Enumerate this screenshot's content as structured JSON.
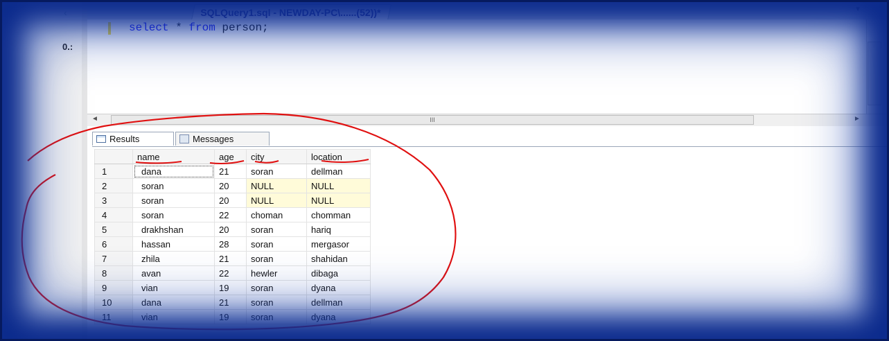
{
  "window": {
    "tab_title": "SQLQuery1.sql - NEWDAY-PC\\......(52))*",
    "left_pane_marker": "0.:"
  },
  "editor": {
    "query": {
      "kw1": "select",
      "rest1": " * ",
      "kw2": "from",
      "rest2": " person;"
    },
    "hscroll_mark": "III"
  },
  "results": {
    "tabs": [
      "Results",
      "Messages"
    ],
    "columns": [
      "name",
      "age",
      "city",
      "location"
    ],
    "rows": [
      {
        "n": "1",
        "name": "dana",
        "age": "21",
        "city": "soran",
        "location": "dellman"
      },
      {
        "n": "2",
        "name": "soran",
        "age": "20",
        "city": "NULL",
        "location": "NULL"
      },
      {
        "n": "3",
        "name": "soran",
        "age": "20",
        "city": "NULL",
        "location": "NULL"
      },
      {
        "n": "4",
        "name": "soran",
        "age": "22",
        "city": "choman",
        "location": "chomman"
      },
      {
        "n": "5",
        "name": "drakhshan",
        "age": "20",
        "city": "soran",
        "location": "hariq"
      },
      {
        "n": "6",
        "name": "hassan",
        "age": "28",
        "city": "soran",
        "location": "mergasor"
      },
      {
        "n": "7",
        "name": "zhila",
        "age": "21",
        "city": "soran",
        "location": "shahidan"
      },
      {
        "n": "8",
        "name": "avan",
        "age": "22",
        "city": "hewler",
        "location": "dibaga"
      },
      {
        "n": "9",
        "name": "vian",
        "age": "19",
        "city": "soran",
        "location": "dyana"
      },
      {
        "n": "10",
        "name": "dana",
        "age": "21",
        "city": "soran",
        "location": "dellman"
      },
      {
        "n": "11",
        "name": "vian",
        "age": "19",
        "city": "soran",
        "location": "dyana"
      }
    ]
  },
  "colors": {
    "annotation": "#e01010",
    "frame_glow": "#0b2a8c",
    "keyword": "#2020ff"
  }
}
